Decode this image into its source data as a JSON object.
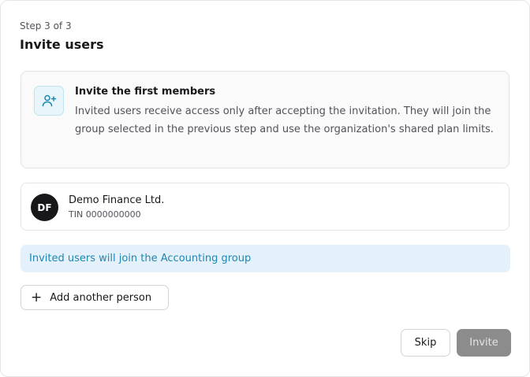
{
  "step": "Step 3 of 3",
  "title": "Invite users",
  "info": {
    "icon": "user-plus-icon",
    "title": "Invite the first members",
    "text": "Invited users receive access only after accepting the invitation. They will join the group selected in the previous step and use the organization's shared plan limits."
  },
  "company": {
    "initials": "DF",
    "name": "Demo Finance Ltd.",
    "tin": "TIN 0000000000"
  },
  "notice": "Invited users will join the Accounting group",
  "add_button": {
    "icon": "plus-icon",
    "label": "Add another person"
  },
  "actions": {
    "skip": "Skip",
    "invite": "Invite"
  },
  "colors": {
    "accent_text": "#1e86b3",
    "notice_bg": "#e5f1fa",
    "icon_bg": "#e8f5fb",
    "avatar_bg": "#18181b",
    "disabled_button": "#8c8c8c"
  }
}
